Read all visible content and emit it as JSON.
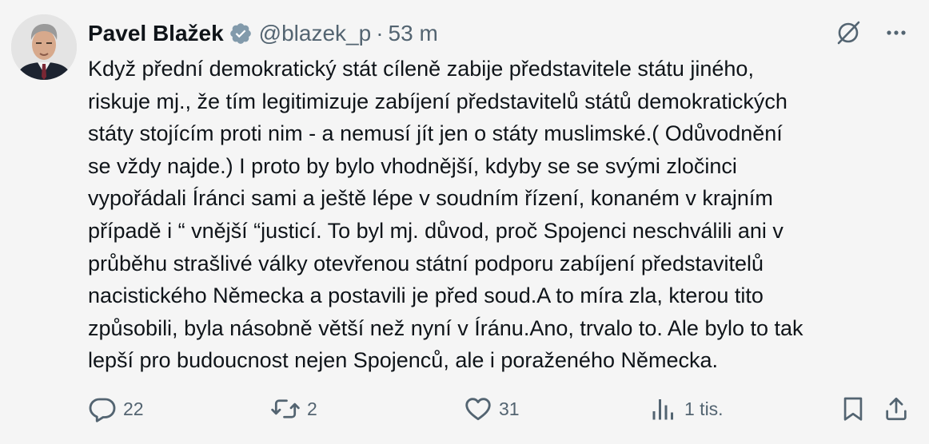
{
  "author": {
    "name": "Pavel Blažek",
    "handle": "@blazek_p",
    "separator": "·",
    "time": "53 m"
  },
  "icons": {
    "verified": "verified-badge-icon",
    "grok": "grok-icon",
    "more": "more-icon",
    "reply": "reply-icon",
    "repost": "repost-icon",
    "like": "like-icon",
    "views": "views-icon",
    "bookmark": "bookmark-icon",
    "share": "share-icon"
  },
  "colors": {
    "background": "#f5f5f5",
    "text": "#0f1419",
    "muted": "#536471",
    "verified_badge": "#829aab"
  },
  "post": {
    "lines": [
      "Když přední demokratický stát cíleně zabije představitele státu jiného,",
      "riskuje mj., že tím legitimizuje zabíjení představitelů států demokratických",
      "státy stojícím proti nim - a nemusí jít jen o státy muslimské.( Odůvodnění",
      "se vždy najde.) I proto by bylo vhodnější, kdyby se se svými zločinci",
      "vypořádali Íránci sami a ještě lépe  v soudním řízení, konaném v krajním",
      "případě i “ vnější “justicí. To byl mj. důvod, proč Spojenci  neschválili ani v",
      "průběhu strašlivé války otevřenou státní podporu zabíjení představitelů",
      "nacistického Německa  a postavili je před soud.A to míra zla, kterou tito",
      "způsobili, byla násobně větší než nyní v Íránu.Ano, trvalo to. Ale bylo to tak",
      "lepší pro budoucnost nejen Spojenců, ale i poraženého Německa."
    ]
  },
  "actions": {
    "replies": "22",
    "reposts": "2",
    "likes": "31",
    "views": "1 tis."
  }
}
